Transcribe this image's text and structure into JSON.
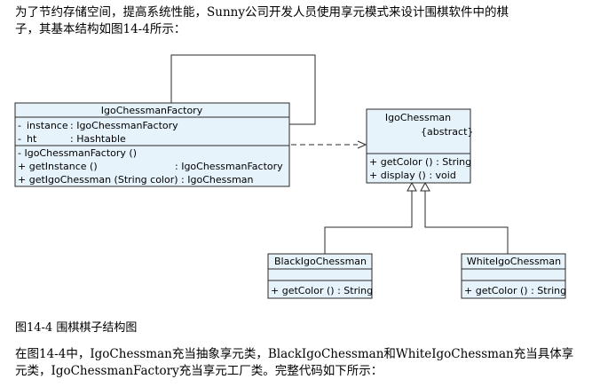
{
  "intro": {
    "line1": "为了节约存储空间，提高系统性能，Sunny公司开发人员使用享元模式来设计围棋软件中的棋",
    "line2": "子，其基本结构如图14-4所示："
  },
  "diagram": {
    "factory": {
      "name": "IgoChessmanFactory",
      "attr1_sign": "-",
      "attr1_name": "instance",
      "attr1_type": ": IgoChessmanFactory",
      "attr2_sign": "-",
      "attr2_name": "ht",
      "attr2_type": ": Hashtable",
      "op1": "-  IgoChessmanFactory ()",
      "op2_sig": "+  getInstance ()",
      "op2_ret": ": IgoChessmanFactory",
      "op3": "+  getIgoChessman (String color)  : IgoChessman"
    },
    "chessman": {
      "name": "IgoChessman",
      "stereotype": "{abstract}",
      "op1": "+  getColor ()  : String",
      "op2": "+  display ()    : void"
    },
    "black": {
      "name": "BlackIgoChessman",
      "op1": "+  getColor () : String"
    },
    "white": {
      "name": "WhiteIgoChessman",
      "op1": "+  getColor () : String"
    }
  },
  "caption": "图14-4 围棋棋子结构图",
  "closing": {
    "line1": "在图14-4中，IgoChessman充当抽象享元类，BlackIgoChessman和WhiteIgoChessman充当具体享",
    "line2": "元类，IgoChessmanFactory充当享元工厂类。完整代码如下所示："
  }
}
